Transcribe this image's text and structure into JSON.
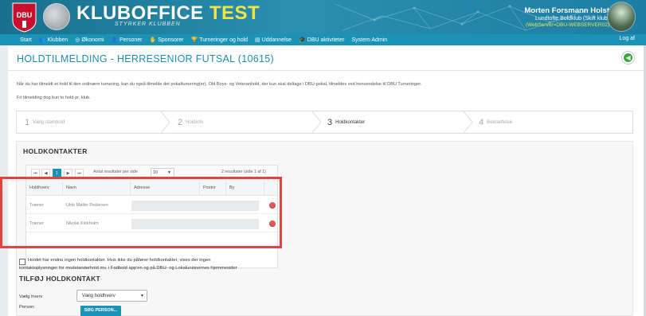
{
  "header": {
    "brand_main": "KLUBOFFICE",
    "brand_suffix": "TEST",
    "tagline": "STYRKER KLUBBEN",
    "user_name": "Morten Forsmann Holst",
    "user_club": "Lundtofte Boldklub (Skift klub)",
    "server": "(WebServer=DBU-WEBSERVER02)"
  },
  "nav": {
    "items": [
      {
        "label": "Start",
        "icon": ""
      },
      {
        "label": "Klubben",
        "icon": "users-icon"
      },
      {
        "label": "Økonomi",
        "icon": "coin-icon"
      },
      {
        "label": "Personer",
        "icon": "person-icon"
      },
      {
        "label": "Sponsorer",
        "icon": "handshake-icon"
      },
      {
        "label": "Turneringer og hold",
        "icon": "trophy-icon"
      },
      {
        "label": "Uddannelse",
        "icon": "book-icon"
      },
      {
        "label": "DBU aktiviteter",
        "icon": "graduation-icon"
      },
      {
        "label": "System Admin",
        "icon": ""
      }
    ],
    "logout": "Log af"
  },
  "page": {
    "title": "HOLDTILMELDING - HERRESENIOR FUTSAL (10615)",
    "info_line_1": "Når du har tilmeldt et hold til den ordinære turnering, kan du også tilmelde det pokalturnering(er). Old Boys- og Veteranhold, der kun skal deltage i DBU-pokal, tilmeldes ved henvendelse til DBU Turneringer.",
    "info_line_2": "Fri tilmelding dog kun to hold pr. klub."
  },
  "wizard": {
    "steps": [
      {
        "num": "1",
        "label": "Vælg stamhold",
        "active": false
      },
      {
        "num": "2",
        "label": "Holdinfo",
        "active": false
      },
      {
        "num": "3",
        "label": "Holdkontakter",
        "active": true
      },
      {
        "num": "4",
        "label": "Bekræftelse",
        "active": false
      }
    ]
  },
  "contacts": {
    "title": "HOLDKONTAKTER",
    "pager": {
      "first": "⏮",
      "prev": "◀",
      "current_page": "1",
      "next": "▶",
      "last": "⏭",
      "per_page_label": "Antal resultater per side",
      "per_page_value": "10",
      "count_text": "2 resultater (side 1 af 1)"
    },
    "columns": [
      "Holdhverv",
      "Navn",
      "Adresse",
      "Postnr",
      "By"
    ],
    "rows": [
      {
        "role": "Træner",
        "name": "Ulrik Møller Pedersen"
      },
      {
        "role": "Træner",
        "name": "Nikolai Klokholm"
      }
    ],
    "no_contacts_line_1": "Holdet har endnu ingen holdkontakter. Hvis ikke du påfører holdkontakter, vises der ingen",
    "no_contacts_line_2": "kontaktoplysninger for modstanderhold mv. i Fodbold app'en og på DBU- og Lokalunionernes hjemmesider"
  },
  "add_contact": {
    "title": "TILFØJ HOLDKONTAKT",
    "role_label": "Vælg hverv",
    "role_value": "Vælg holdhverv",
    "person_label": "Person:",
    "search_button": "SØG PERSON..."
  },
  "colors": {
    "accent": "#1b93b7",
    "title": "#1d8fb4",
    "brand_suffix": "#f2e447",
    "highlight": "#e0453f",
    "delete": "#e05858"
  }
}
